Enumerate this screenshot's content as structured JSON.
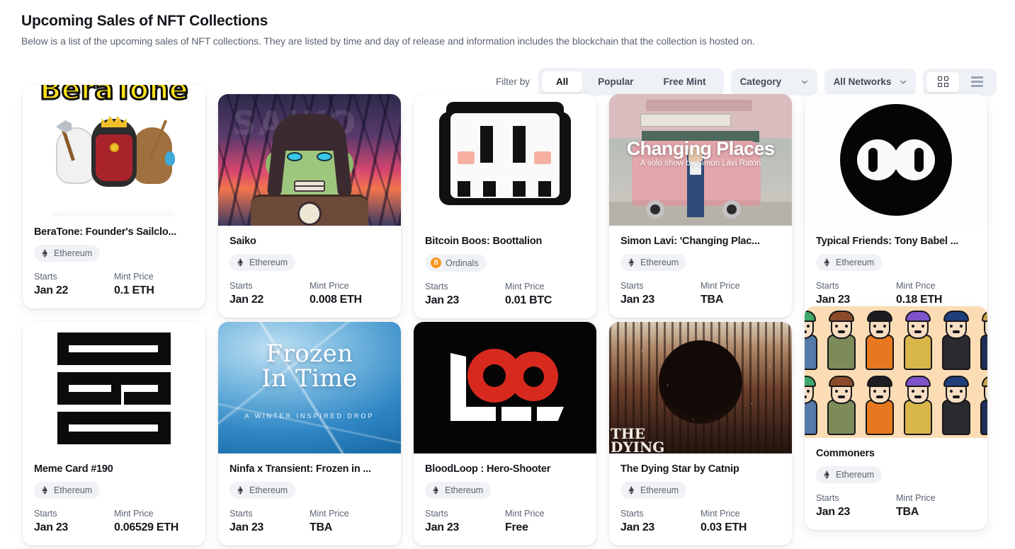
{
  "header": {
    "title": "Upcoming Sales of NFT Collections",
    "subtitle": "Below is a list of the upcoming sales of NFT collections. They are listed by time and day of release and information includes the blockchain that the collection is hosted on."
  },
  "filters": {
    "label": "Filter by",
    "segments": [
      {
        "label": "All",
        "active": true
      },
      {
        "label": "Popular",
        "active": false
      },
      {
        "label": "Free Mint",
        "active": false
      }
    ],
    "category_dropdown": "Category",
    "network_dropdown": "All Networks",
    "view_grid_icon": "grid-view-icon",
    "view_list_icon": "list-view-icon",
    "active_view": "grid"
  },
  "labels": {
    "starts": "Starts",
    "mint_price": "Mint Price"
  },
  "cards": [
    {
      "title": "BeraTone: Founder's Sailclo...",
      "chain": "Ethereum",
      "chain_icon": "ethereum-icon",
      "starts": "Jan 22",
      "price": "0.1 ETH",
      "art": "beratone",
      "overlay_title": "BeraTone"
    },
    {
      "title": "Saiko",
      "chain": "Ethereum",
      "chain_icon": "ethereum-icon",
      "starts": "Jan 22",
      "price": "0.008 ETH",
      "art": "saiko",
      "overlay_title": ""
    },
    {
      "title": "Bitcoin Boos: Boottalion",
      "chain": "Ordinals",
      "chain_icon": "bitcoin-icon",
      "starts": "Jan 23",
      "price": "0.01 BTC",
      "art": "boos",
      "overlay_title": ""
    },
    {
      "title": "Simon Lavi: 'Changing Plac...",
      "chain": "Ethereum",
      "chain_icon": "ethereum-icon",
      "starts": "Jan 23",
      "price": "TBA",
      "art": "changing-places",
      "overlay_title": "Changing Places",
      "overlay_subtitle": "A solo show by Simon Lavi Raton"
    },
    {
      "title": "Typical Friends: Tony Babel ...",
      "chain": "Ethereum",
      "chain_icon": "ethereum-icon",
      "starts": "Jan 23",
      "price": "0.18 ETH",
      "art": "typical-friends",
      "overlay_title": ""
    },
    {
      "title": "Meme Card #190",
      "chain": "Ethereum",
      "chain_icon": "ethereum-icon",
      "starts": "Jan 23",
      "price": "0.06529 ETH",
      "art": "meme-card",
      "overlay_title": ""
    },
    {
      "title": "Ninfa x Transient: Frozen in ...",
      "chain": "Ethereum",
      "chain_icon": "ethereum-icon",
      "starts": "Jan 23",
      "price": "TBA",
      "art": "frozen",
      "overlay_title": "Frozen In Time",
      "overlay_subtitle": "A WINTER INSPIRED DROP"
    },
    {
      "title": "BloodLoop : Hero-Shooter",
      "chain": "Ethereum",
      "chain_icon": "ethereum-icon",
      "starts": "Jan 23",
      "price": "Free",
      "art": "bloodloop",
      "overlay_title": ""
    },
    {
      "title": "The Dying Star by Catnip",
      "chain": "Ethereum",
      "chain_icon": "ethereum-icon",
      "starts": "Jan 23",
      "price": "0.03 ETH",
      "art": "dying-star",
      "overlay_title": "THE DYING"
    },
    {
      "title": "Commoners",
      "chain": "Ethereum",
      "chain_icon": "ethereum-icon",
      "starts": "Jan 23",
      "price": "TBA",
      "art": "commoners",
      "overlay_title": ""
    }
  ],
  "colors": {
    "accent_orange": "#f7931a",
    "chip_bg": "#eef1f5",
    "text_dark": "#15171c",
    "text_muted": "#5b6472"
  }
}
